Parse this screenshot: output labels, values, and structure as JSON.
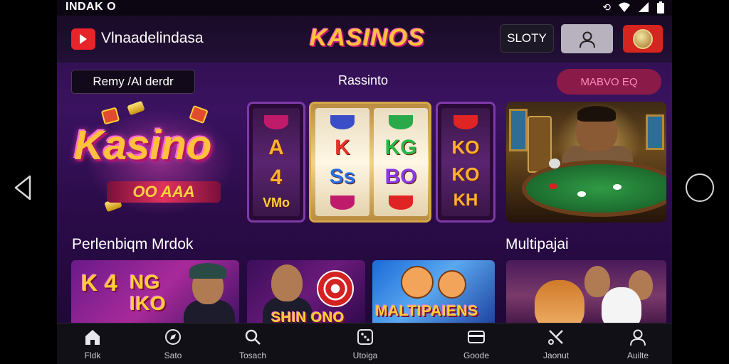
{
  "status_bar": {
    "carrier": "INDAK O",
    "icons": [
      "sync-icon",
      "wifi-icon",
      "signal-icon",
      "battery-icon"
    ]
  },
  "header": {
    "app_name": "Vlnaadelindasa",
    "brand_title": "KASINOS",
    "slot_button": "SLOTY",
    "profile_icon": "user-icon",
    "coin_icon": "coin-icon"
  },
  "filters": {
    "search_pill": "Remy /Al derdr",
    "center_title": "Rassinto",
    "right_pill": "MABVO EQ"
  },
  "hero": {
    "logo_word": "Kasino",
    "logo_ribbon": "OO AAA",
    "reels": {
      "left": [
        "A",
        "4",
        "VMo"
      ],
      "center_left": [
        "K",
        "Ss"
      ],
      "center_right": [
        "KG",
        "BO"
      ],
      "right": [
        "KO",
        "KO",
        "KH"
      ]
    }
  },
  "sections": {
    "left_title": "Perlenbiqm Mrdok",
    "right_title": "Multipajai"
  },
  "tiles": [
    {
      "label": "NG IKO",
      "sub": "K 4"
    },
    {
      "label": "SHIN ONO"
    },
    {
      "label": "MALTIPAIENS"
    },
    {
      "label": ""
    }
  ],
  "bottom_nav": [
    {
      "label": "Fldk",
      "icon": "home-icon"
    },
    {
      "label": "Sato",
      "icon": "compass-icon"
    },
    {
      "label": "Tosach",
      "icon": "search-icon"
    },
    {
      "label": "Utoiga",
      "icon": "dice-icon"
    },
    {
      "label": "Goode",
      "icon": "card-icon"
    },
    {
      "label": "Jaonut",
      "icon": "tools-icon"
    },
    {
      "label": "Auilte",
      "icon": "person-icon"
    }
  ],
  "colors": {
    "brand_gold": "#ffc23a",
    "brand_pink": "#ff44c8",
    "background_purple": "#3a1260",
    "accent_red": "#e8232a"
  }
}
